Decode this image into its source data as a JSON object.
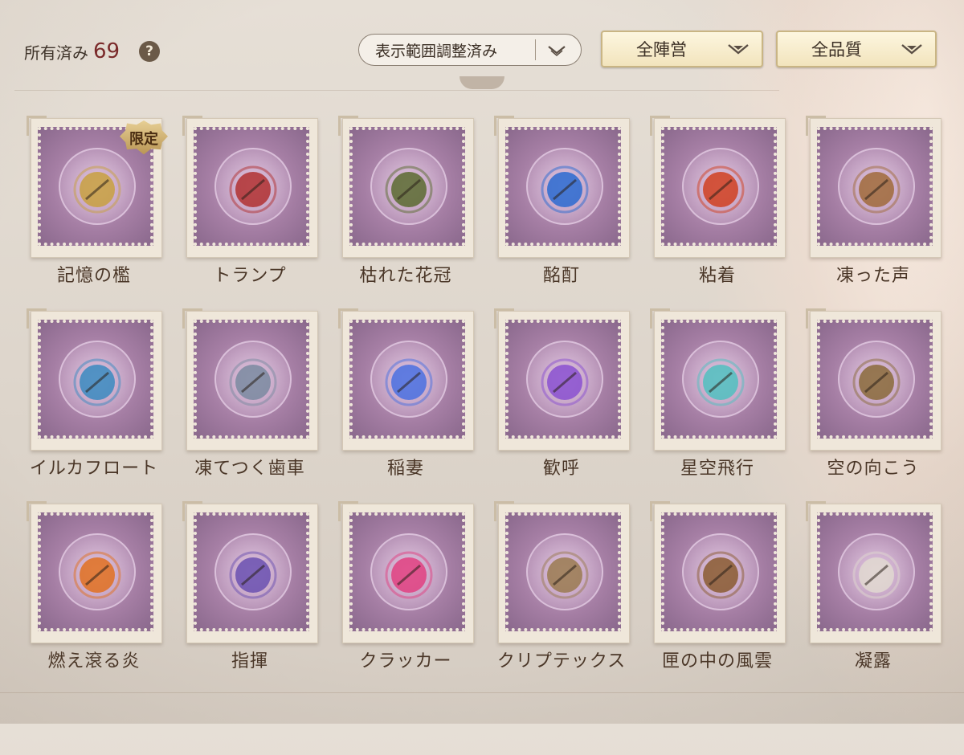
{
  "header": {
    "owned_label": "所有済み",
    "owned_count": "69",
    "help_symbol": "?",
    "filter_display": "表示範囲調整済み",
    "filter_faction": "全陣営",
    "filter_quality": "全品質"
  },
  "items": [
    {
      "name": "記憶の檻",
      "badge": "限定",
      "icon": "bell-cage-icon",
      "accent": "#c8a040"
    },
    {
      "name": "トランプ",
      "icon": "card-deck-icon",
      "accent": "#b03030"
    },
    {
      "name": "枯れた花冠",
      "icon": "wreath-icon",
      "accent": "#5a6a30"
    },
    {
      "name": "酩酊",
      "icon": "blue-heart-gem-icon",
      "accent": "#2a6ad0"
    },
    {
      "name": "粘着",
      "icon": "fire-ring-pendant-icon",
      "accent": "#d04020"
    },
    {
      "name": "凍った声",
      "icon": "bronze-vase-icon",
      "accent": "#a06a3a"
    },
    {
      "name": "イルカフロート",
      "icon": "dolphin-float-icon",
      "accent": "#3a8ac0"
    },
    {
      "name": "凍てつく歯車",
      "icon": "gear-orb-icon",
      "accent": "#7a8aa0"
    },
    {
      "name": "稲妻",
      "icon": "lightning-boot-icon",
      "accent": "#4a70e0"
    },
    {
      "name": "歓呼",
      "icon": "pom-scepter-icon",
      "accent": "#8a50d0"
    },
    {
      "name": "星空飛行",
      "icon": "crystal-eagle-icon",
      "accent": "#50c0c0"
    },
    {
      "name": "空の向こう",
      "icon": "telescope-icon",
      "accent": "#8a6a3a"
    },
    {
      "name": "燃え滾る炎",
      "icon": "flame-torches-icon",
      "accent": "#e07020"
    },
    {
      "name": "指揮",
      "icon": "baton-icon",
      "accent": "#6a50b0"
    },
    {
      "name": "クラッカー",
      "icon": "party-cracker-icon",
      "accent": "#e04080"
    },
    {
      "name": "クリプテックス",
      "icon": "cryptex-icon",
      "accent": "#9a7a50"
    },
    {
      "name": "匣の中の風雲",
      "icon": "treasure-box-icon",
      "accent": "#8a5a30"
    },
    {
      "name": "凝露",
      "icon": "dew-orb-icon",
      "accent": "#e0d8d0"
    }
  ]
}
